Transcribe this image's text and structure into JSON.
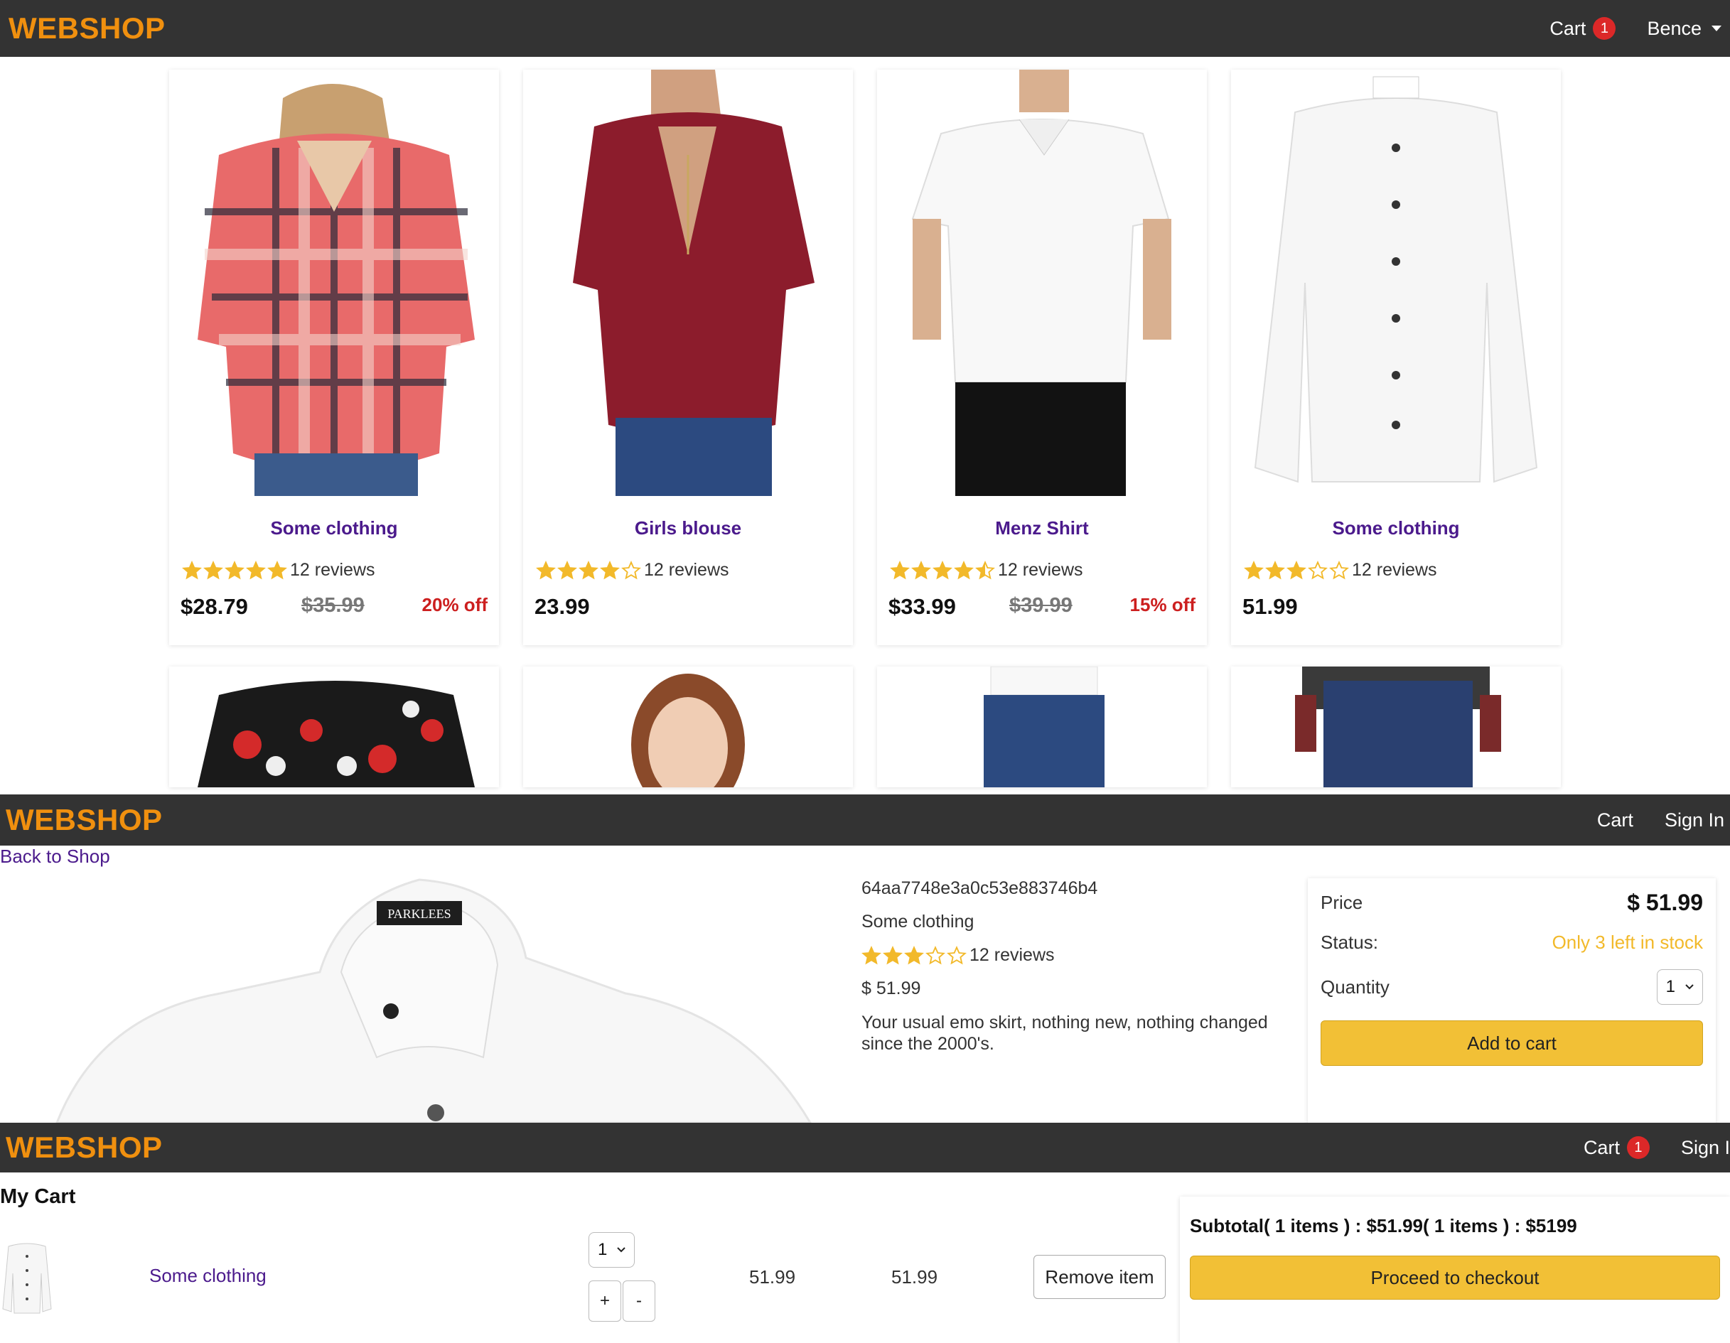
{
  "brand": "WEBSHOP",
  "nav_home": {
    "cart": "Cart",
    "cart_count": "1",
    "user": "Bence"
  },
  "nav_product": {
    "cart": "Cart",
    "signin": "Sign In"
  },
  "nav_cart": {
    "cart": "Cart",
    "cart_count": "1",
    "signin": "Sign I"
  },
  "products": [
    {
      "name": "Some clothing",
      "rating": 5,
      "reviews": "12 reviews",
      "price": "$28.79",
      "old_price": "$35.99",
      "discount": "20% off"
    },
    {
      "name": "Girls blouse",
      "rating": 4,
      "reviews": "12 reviews",
      "price": "23.99"
    },
    {
      "name": "Menz Shirt",
      "rating": 4.5,
      "reviews": "12 reviews",
      "price": "$33.99",
      "old_price": "$39.99",
      "discount": "15% off"
    },
    {
      "name": "Some clothing",
      "rating": 3,
      "reviews": "12 reviews",
      "price": "51.99"
    }
  ],
  "detail": {
    "back": "Back to Shop",
    "id": "64aa7748e3a0c53e883746b4",
    "name": "Some clothing",
    "rating": 3,
    "reviews": "12 reviews",
    "price": "$ 51.99",
    "description": "Your usual emo skirt, nothing new, nothing changed since the 2000's.",
    "price_label": "Price",
    "price_value": "$ 51.99",
    "status_label": "Status:",
    "status_value": "Only 3 left in stock",
    "quantity_label": "Quantity",
    "quantity_value": "1",
    "add_to_cart": "Add to cart"
  },
  "cart": {
    "title": "My Cart",
    "item": {
      "name": "Some clothing",
      "qty": "1",
      "price": "51.99",
      "total": "51.99",
      "plus": "+",
      "minus": "-",
      "remove": "Remove item"
    },
    "subtotal": "Subtotal( 1 items ) : $51.99( 1 items ) : $5199",
    "checkout": "Proceed to checkout"
  },
  "colors": {
    "navbar": "#333333",
    "brand": "#f0900f",
    "badge": "#dc2828",
    "star": "#f2b92a",
    "link": "#4b1a8c",
    "discount": "#cc1f1f",
    "button": "#f2c036"
  },
  "icons": {
    "star": "star-icon",
    "caret": "caret-down-icon",
    "chevron": "chevron-down-icon"
  }
}
